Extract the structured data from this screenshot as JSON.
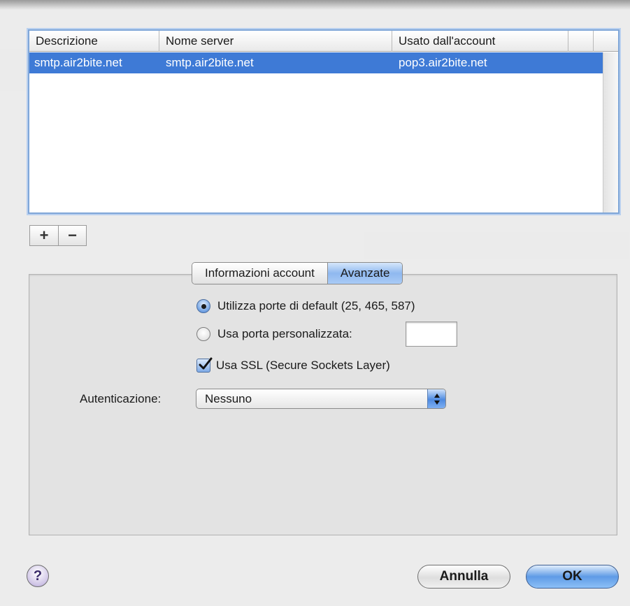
{
  "table": {
    "columns": [
      "Descrizione",
      "Nome server",
      "Usato dall'account",
      "",
      ""
    ],
    "rows": [
      {
        "descrizione": "smtp.air2bite.net",
        "nome_server": "smtp.air2bite.net",
        "usato": "pop3.air2bite.net",
        "selected": true
      }
    ]
  },
  "list_buttons": {
    "add": "+",
    "remove": "−"
  },
  "tabs": [
    {
      "label": "Informazioni account",
      "active": false
    },
    {
      "label": "Avanzate",
      "active": true
    }
  ],
  "advanced": {
    "default_ports_label": "Utilizza porte di default (25, 465, 587)",
    "default_ports_selected": true,
    "custom_port_label": "Usa porta personalizzata:",
    "custom_port_value": "",
    "ssl_label": "Usa SSL (Secure Sockets Layer)",
    "ssl_checked": true,
    "auth_label": "Autenticazione:",
    "auth_value": "Nessuno"
  },
  "footer": {
    "help": "?",
    "cancel": "Annulla",
    "ok": "OK"
  },
  "colors": {
    "selection": "#3e7ad6",
    "accent": "#5f9be6"
  }
}
